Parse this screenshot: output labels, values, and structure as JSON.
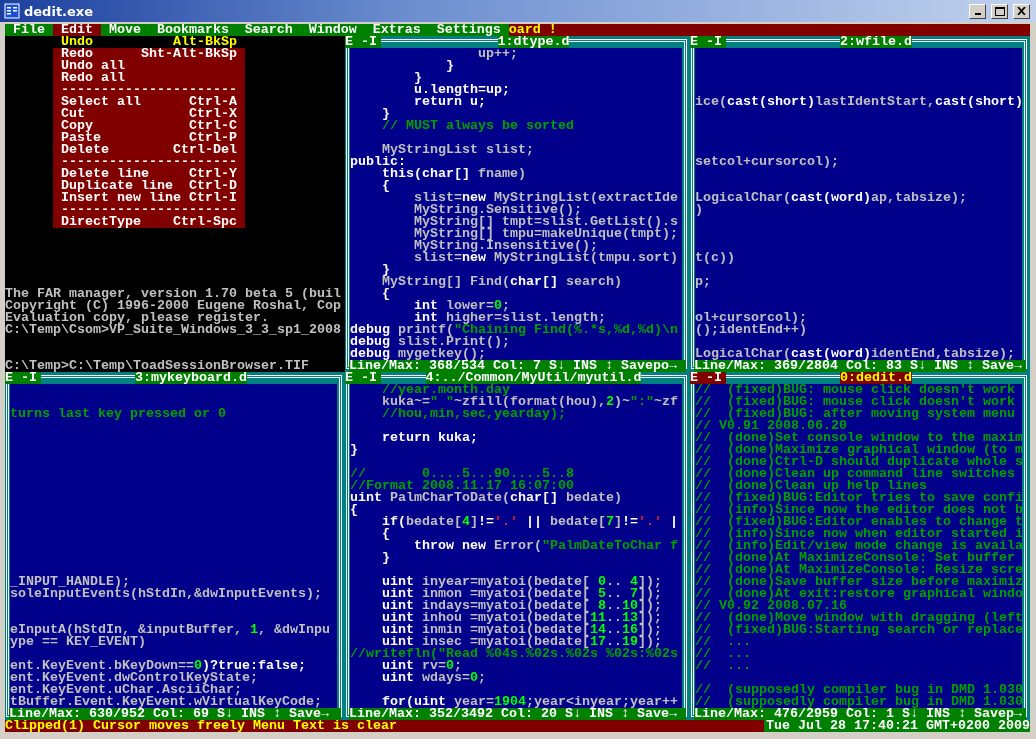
{
  "window": {
    "title": "dedit.exe"
  },
  "menu": {
    "items": [
      {
        "label": "File",
        "selected": false
      },
      {
        "label": "Edit",
        "selected": true
      },
      {
        "label": "Move",
        "selected": false
      },
      {
        "label": "Bookmarks",
        "selected": false
      },
      {
        "label": "Search",
        "selected": false
      },
      {
        "label": "Window",
        "selected": false
      },
      {
        "label": "Extras",
        "selected": false
      },
      {
        "label": "Settings",
        "selected": false
      }
    ],
    "background_text": "oard !"
  },
  "dropdown": [
    {
      "kind": "item",
      "label": "Undo",
      "shortcut": "Alt-BkSp",
      "selected": true
    },
    {
      "kind": "item",
      "label": "Redo",
      "shortcut": "Sht-Alt-BkSp",
      "selected": false
    },
    {
      "kind": "item",
      "label": "Undo all",
      "selected": false
    },
    {
      "kind": "item",
      "label": "Redo all",
      "selected": false
    },
    {
      "kind": "separator",
      "label": "----------------------",
      "selected": false
    },
    {
      "kind": "item",
      "label": "Select all",
      "shortcut": "Ctrl-A",
      "selected": false
    },
    {
      "kind": "item",
      "label": "Cut",
      "shortcut": "Ctrl-X",
      "selected": false
    },
    {
      "kind": "item",
      "label": "Copy",
      "shortcut": "Ctrl-C",
      "selected": false
    },
    {
      "kind": "item",
      "label": "Paste",
      "shortcut": "Ctrl-P",
      "selected": false
    },
    {
      "kind": "item",
      "label": "Delete",
      "shortcut": "Ctrl-Del",
      "selected": false
    },
    {
      "kind": "separator",
      "label": "----------------------",
      "selected": false
    },
    {
      "kind": "item",
      "label": "Delete line",
      "shortcut": "Ctrl-Y",
      "selected": false
    },
    {
      "kind": "item",
      "label": "Duplicate line",
      "shortcut": "Ctrl-D",
      "selected": false
    },
    {
      "kind": "item",
      "label": "Insert new line",
      "shortcut": "Ctrl-I",
      "selected": false
    },
    {
      "kind": "separator",
      "label": "----------------------",
      "selected": false
    },
    {
      "kind": "item",
      "label": "DirectType",
      "shortcut": "Ctrl-Spc",
      "selected": false
    }
  ],
  "console": {
    "lines": [
      {
        "kind": "text",
        "text": "The FAR manager, version 1.70 beta 5 (buil"
      },
      {
        "kind": "text",
        "text": "Copyright (C) 1996-2000 Eugene Roshal, Cop"
      },
      {
        "kind": "text",
        "text": "Evaluation copy, please register."
      },
      {
        "kind": "text",
        "text": "C:\\Temp\\Csom>VP_Suite_Windows_3_3_sp1_2008"
      },
      {
        "kind": "blank"
      },
      {
        "kind": "blank"
      },
      {
        "kind": "text",
        "text": "C:\\Temp>C:\\Temp\\ToadSessionBrowser.TIF"
      }
    ]
  },
  "top_panes": [
    {
      "mode": "E -I",
      "title": "1:dtype.d",
      "active": false,
      "status": "Line/Max: 368/534 Col: 7 S↓ INS ↕ Savepo→",
      "lines": [
        {
          "kind": "code",
          "segments": [
            {
              "kind": "plain",
              "text": "                up++;"
            }
          ]
        },
        {
          "kind": "code",
          "segments": [
            {
              "kind": "key",
              "text": "            }"
            }
          ]
        },
        {
          "kind": "code",
          "segments": [
            {
              "kind": "key",
              "text": "        }"
            }
          ]
        },
        {
          "kind": "code",
          "segments": [
            {
              "kind": "key",
              "text": "        u.length=up;"
            }
          ]
        },
        {
          "kind": "code",
          "segments": [
            {
              "kind": "key",
              "text": "        return u;"
            }
          ]
        },
        {
          "kind": "code",
          "segments": [
            {
              "kind": "key",
              "text": "    }"
            }
          ]
        },
        {
          "kind": "code",
          "segments": [
            {
              "kind": "comment",
              "text": "    // MUST always be sorted"
            }
          ]
        },
        {
          "kind": "blank"
        },
        {
          "kind": "code",
          "segments": [
            {
              "kind": "plain",
              "text": "    MyStringList slist;"
            }
          ]
        },
        {
          "kind": "code",
          "segments": [
            {
              "kind": "key",
              "text": "public:"
            }
          ]
        },
        {
          "kind": "code",
          "segments": [
            {
              "kind": "key",
              "text": "    this(char[]"
            },
            {
              "kind": "plain",
              "text": " fname)"
            }
          ]
        },
        {
          "kind": "code",
          "segments": [
            {
              "kind": "key",
              "text": "    {"
            }
          ]
        },
        {
          "kind": "code",
          "segments": [
            {
              "kind": "plain",
              "text": "        slist="
            },
            {
              "kind": "key",
              "text": "new"
            },
            {
              "kind": "plain",
              "text": " MyStringList(extractIde"
            }
          ]
        },
        {
          "kind": "code",
          "segments": [
            {
              "kind": "plain",
              "text": "        MyString.Sensitive();"
            }
          ]
        },
        {
          "kind": "code",
          "segments": [
            {
              "kind": "plain",
              "text": "        MyString[] tmpt=slist.GetList().s"
            }
          ]
        },
        {
          "kind": "code",
          "segments": [
            {
              "kind": "plain",
              "text": "        MyString[] tmpu=makeUnique(tmpt);"
            }
          ]
        },
        {
          "kind": "code",
          "segments": [
            {
              "kind": "plain",
              "text": "        MyString.Insensitive();"
            }
          ]
        },
        {
          "kind": "code",
          "segments": [
            {
              "kind": "plain",
              "text": "        slist="
            },
            {
              "kind": "key",
              "text": "new"
            },
            {
              "kind": "plain",
              "text": " MyStringList(tmpu.sort)"
            }
          ]
        },
        {
          "kind": "code",
          "segments": [
            {
              "kind": "key",
              "text": "    }"
            }
          ]
        },
        {
          "kind": "code",
          "segments": [
            {
              "kind": "plain",
              "text": "    MyString[] Find("
            },
            {
              "kind": "key",
              "text": "char[]"
            },
            {
              "kind": "plain",
              "text": " search)"
            }
          ]
        },
        {
          "kind": "code",
          "segments": [
            {
              "kind": "key",
              "text": "    {"
            }
          ]
        },
        {
          "kind": "code",
          "segments": [
            {
              "kind": "key",
              "text": "        int"
            },
            {
              "kind": "plain",
              "text": " lower="
            },
            {
              "kind": "number",
              "text": "0"
            },
            {
              "kind": "plain",
              "text": ";"
            }
          ]
        },
        {
          "kind": "code",
          "segments": [
            {
              "kind": "key",
              "text": "        int"
            },
            {
              "kind": "plain",
              "text": " higher=slist.length;"
            }
          ]
        },
        {
          "kind": "code",
          "segments": [
            {
              "kind": "key",
              "text": "debug"
            },
            {
              "kind": "plain",
              "text": " printf("
            },
            {
              "kind": "comment",
              "text": "\"Chaining Find(%.*s,%d,%d)\\n"
            }
          ]
        },
        {
          "kind": "code",
          "segments": [
            {
              "kind": "key",
              "text": "debug"
            },
            {
              "kind": "plain",
              "text": " slist.Print();"
            }
          ]
        },
        {
          "kind": "code",
          "segments": [
            {
              "kind": "key",
              "text": "debug"
            },
            {
              "kind": "plain",
              "text": " mygetkey();"
            }
          ]
        }
      ]
    },
    {
      "mode": "E -I",
      "title": "2:wfile.d",
      "active": false,
      "status": "Line/Max: 369/2804 Col: 83 S↓ INS ↕ Save→",
      "lines": [
        {
          "kind": "blank"
        },
        {
          "kind": "blank"
        },
        {
          "kind": "blank"
        },
        {
          "kind": "blank"
        },
        {
          "kind": "code",
          "segments": [
            {
              "kind": "plain",
              "text": "ice("
            },
            {
              "kind": "key",
              "text": "cast(short)"
            },
            {
              "kind": "plain",
              "text": "lastIdentStart,"
            },
            {
              "kind": "key",
              "text": "cast(short)"
            }
          ]
        },
        {
          "kind": "blank"
        },
        {
          "kind": "blank"
        },
        {
          "kind": "blank"
        },
        {
          "kind": "blank"
        },
        {
          "kind": "code",
          "segments": [
            {
              "kind": "plain",
              "text": "setcol+cursorcol);"
            }
          ]
        },
        {
          "kind": "blank"
        },
        {
          "kind": "blank"
        },
        {
          "kind": "code",
          "segments": [
            {
              "kind": "plain",
              "text": "LogicalChar("
            },
            {
              "kind": "key",
              "text": "cast(word)"
            },
            {
              "kind": "plain",
              "text": "ap,tabsize);"
            }
          ]
        },
        {
          "kind": "code",
          "segments": [
            {
              "kind": "plain",
              "text": ")"
            }
          ]
        },
        {
          "kind": "blank"
        },
        {
          "kind": "blank"
        },
        {
          "kind": "blank"
        },
        {
          "kind": "code",
          "segments": [
            {
              "kind": "plain",
              "text": "t(c))"
            }
          ]
        },
        {
          "kind": "blank"
        },
        {
          "kind": "code",
          "segments": [
            {
              "kind": "plain",
              "text": "p;"
            }
          ]
        },
        {
          "kind": "blank"
        },
        {
          "kind": "blank"
        },
        {
          "kind": "code",
          "segments": [
            {
              "kind": "plain",
              "text": "ol+cursorcol);"
            }
          ]
        },
        {
          "kind": "code",
          "segments": [
            {
              "kind": "plain",
              "text": "();identEnd++)"
            }
          ]
        },
        {
          "kind": "blank"
        },
        {
          "kind": "code",
          "segments": [
            {
              "kind": "plain",
              "text": "LogicalChar("
            },
            {
              "kind": "key",
              "text": "cast(word)"
            },
            {
              "kind": "plain",
              "text": "identEnd,tabsize);"
            }
          ]
        }
      ]
    }
  ],
  "bottom_panes": [
    {
      "mode": "E -I",
      "title": "3:mykeyboard.d",
      "active": false,
      "status": "Line/Max: 630/952 Col: 69 S↓ INS ↕ Save→",
      "lines": [
        {
          "kind": "blank"
        },
        {
          "kind": "blank"
        },
        {
          "kind": "code",
          "segments": [
            {
              "kind": "comment",
              "text": "turns last key pressed or 0"
            }
          ]
        },
        {
          "kind": "blank"
        },
        {
          "kind": "blank"
        },
        {
          "kind": "blank"
        },
        {
          "kind": "blank"
        },
        {
          "kind": "blank"
        },
        {
          "kind": "blank"
        },
        {
          "kind": "blank"
        },
        {
          "kind": "blank"
        },
        {
          "kind": "blank"
        },
        {
          "kind": "blank"
        },
        {
          "kind": "blank"
        },
        {
          "kind": "blank"
        },
        {
          "kind": "blank"
        },
        {
          "kind": "code",
          "segments": [
            {
              "kind": "plain",
              "text": "_INPUT_HANDLE);"
            }
          ]
        },
        {
          "kind": "code",
          "segments": [
            {
              "kind": "plain",
              "text": "soleInputEvents(hStdIn,&dwInputEvents);"
            }
          ]
        },
        {
          "kind": "blank"
        },
        {
          "kind": "blank"
        },
        {
          "kind": "code",
          "segments": [
            {
              "kind": "plain",
              "text": "eInputA(hStdIn, &inputBuffer, "
            },
            {
              "kind": "number",
              "text": "1"
            },
            {
              "kind": "plain",
              "text": ", &dwInpu"
            }
          ]
        },
        {
          "kind": "code",
          "segments": [
            {
              "kind": "plain",
              "text": "ype == KEY_EVENT)"
            }
          ]
        },
        {
          "kind": "blank"
        },
        {
          "kind": "code",
          "segments": [
            {
              "kind": "plain",
              "text": "ent.KeyEvent.bKeyDown=="
            },
            {
              "kind": "number",
              "text": "0"
            },
            {
              "kind": "key",
              "text": ")?true:false;"
            }
          ]
        },
        {
          "kind": "code",
          "segments": [
            {
              "kind": "plain",
              "text": "ent.KeyEvent.dwControlKeyState;"
            }
          ]
        },
        {
          "kind": "code",
          "segments": [
            {
              "kind": "plain",
              "text": "ent.KeyEvent.uChar.AsciiChar;"
            }
          ]
        },
        {
          "kind": "code",
          "segments": [
            {
              "kind": "plain",
              "text": "tBuffer.Event.KeyEvent.wVirtualKeyCode;"
            }
          ]
        }
      ]
    },
    {
      "mode": "E -I",
      "title": "4:../Common/MyUtil/myutil.d",
      "active": false,
      "status": "Line/Max: 352/3492 Col: 20 S↓ INS ↕ Save→",
      "lines": [
        {
          "kind": "code",
          "segments": [
            {
              "kind": "comment",
              "text": "    //year.month.day"
            }
          ]
        },
        {
          "kind": "code",
          "segments": [
            {
              "kind": "plain",
              "text": "    kuka~="
            },
            {
              "kind": "comment",
              "text": "\" \""
            },
            {
              "kind": "plain",
              "text": "~zfill(format(hou),"
            },
            {
              "kind": "number",
              "text": "2"
            },
            {
              "kind": "plain",
              "text": ")~"
            },
            {
              "kind": "comment",
              "text": "\":\""
            },
            {
              "kind": "plain",
              "text": "~zf"
            }
          ]
        },
        {
          "kind": "code",
          "segments": [
            {
              "kind": "comment",
              "text": "    //hou,min,sec,yearday);"
            }
          ]
        },
        {
          "kind": "blank"
        },
        {
          "kind": "code",
          "segments": [
            {
              "kind": "key",
              "text": "    return kuka;"
            }
          ]
        },
        {
          "kind": "code",
          "segments": [
            {
              "kind": "key",
              "text": "}"
            }
          ]
        },
        {
          "kind": "blank"
        },
        {
          "kind": "code",
          "segments": [
            {
              "kind": "comment",
              "text": "//       0....5...90....5..8"
            }
          ]
        },
        {
          "kind": "code",
          "segments": [
            {
              "kind": "comment",
              "text": "//Format 2008.11.17 16:07:00"
            }
          ]
        },
        {
          "kind": "code",
          "segments": [
            {
              "kind": "key",
              "text": "uint"
            },
            {
              "kind": "plain",
              "text": " PalmCharToDate("
            },
            {
              "kind": "key",
              "text": "char[]"
            },
            {
              "kind": "plain",
              "text": " bedate)"
            }
          ]
        },
        {
          "kind": "code",
          "segments": [
            {
              "kind": "key",
              "text": "{"
            }
          ]
        },
        {
          "kind": "code",
          "segments": [
            {
              "kind": "key",
              "text": "    if("
            },
            {
              "kind": "plain",
              "text": "bedate["
            },
            {
              "kind": "number",
              "text": "4"
            },
            {
              "kind": "plain",
              "text": "]"
            },
            {
              "kind": "key",
              "text": "!="
            },
            {
              "kind": "red",
              "text": "'.'"
            },
            {
              "kind": "key",
              "text": " || "
            },
            {
              "kind": "plain",
              "text": "bedate["
            },
            {
              "kind": "number",
              "text": "7"
            },
            {
              "kind": "plain",
              "text": "]"
            },
            {
              "kind": "key",
              "text": "!="
            },
            {
              "kind": "red",
              "text": "'.'"
            },
            {
              "kind": "key",
              "text": " |"
            }
          ]
        },
        {
          "kind": "code",
          "segments": [
            {
              "kind": "key",
              "text": "    {"
            }
          ]
        },
        {
          "kind": "code",
          "segments": [
            {
              "kind": "key",
              "text": "        throw new"
            },
            {
              "kind": "plain",
              "text": " Error("
            },
            {
              "kind": "comment",
              "text": "\"PalmDateToChar f"
            }
          ]
        },
        {
          "kind": "code",
          "segments": [
            {
              "kind": "key",
              "text": "    }"
            }
          ]
        },
        {
          "kind": "blank"
        },
        {
          "kind": "code",
          "segments": [
            {
              "kind": "key",
              "text": "    uint"
            },
            {
              "kind": "plain",
              "text": " inyear=myatoi(bedate[ "
            },
            {
              "kind": "number",
              "text": "0"
            },
            {
              "kind": "plain",
              "text": ".. "
            },
            {
              "kind": "number",
              "text": "4"
            },
            {
              "kind": "plain",
              "text": "]);"
            }
          ]
        },
        {
          "kind": "code",
          "segments": [
            {
              "kind": "key",
              "text": "    uint"
            },
            {
              "kind": "plain",
              "text": " inmon =myatoi(bedate[ "
            },
            {
              "kind": "number",
              "text": "5"
            },
            {
              "kind": "plain",
              "text": ".. "
            },
            {
              "kind": "number",
              "text": "7"
            },
            {
              "kind": "plain",
              "text": "]);"
            }
          ]
        },
        {
          "kind": "code",
          "segments": [
            {
              "kind": "key",
              "text": "    uint"
            },
            {
              "kind": "plain",
              "text": " indays=myatoi(bedate[ "
            },
            {
              "kind": "number",
              "text": "8"
            },
            {
              "kind": "plain",
              "text": ".."
            },
            {
              "kind": "number",
              "text": "10"
            },
            {
              "kind": "plain",
              "text": "]);"
            }
          ]
        },
        {
          "kind": "code",
          "segments": [
            {
              "kind": "key",
              "text": "    uint"
            },
            {
              "kind": "plain",
              "text": " inhou =myatoi(bedate["
            },
            {
              "kind": "number",
              "text": "11"
            },
            {
              "kind": "plain",
              "text": ".."
            },
            {
              "kind": "number",
              "text": "13"
            },
            {
              "kind": "plain",
              "text": "]);"
            }
          ]
        },
        {
          "kind": "code",
          "segments": [
            {
              "kind": "key",
              "text": "    uint"
            },
            {
              "kind": "plain",
              "text": " inmin =myatoi(bedate["
            },
            {
              "kind": "number",
              "text": "14"
            },
            {
              "kind": "plain",
              "text": ".."
            },
            {
              "kind": "number",
              "text": "16"
            },
            {
              "kind": "plain",
              "text": "]);"
            }
          ]
        },
        {
          "kind": "code",
          "segments": [
            {
              "kind": "key",
              "text": "    uint"
            },
            {
              "kind": "plain",
              "text": " insec =myatoi(bedate["
            },
            {
              "kind": "number",
              "text": "17"
            },
            {
              "kind": "plain",
              "text": ".."
            },
            {
              "kind": "number",
              "text": "19"
            },
            {
              "kind": "plain",
              "text": "]);"
            }
          ]
        },
        {
          "kind": "code",
          "segments": [
            {
              "kind": "comment",
              "text": "//writefln(\"Read %04s.%02s.%02s %02s:%02s"
            }
          ]
        },
        {
          "kind": "code",
          "segments": [
            {
              "kind": "key",
              "text": "    uint"
            },
            {
              "kind": "plain",
              "text": " rv="
            },
            {
              "kind": "number",
              "text": "0"
            },
            {
              "kind": "plain",
              "text": ";"
            }
          ]
        },
        {
          "kind": "code",
          "segments": [
            {
              "kind": "key",
              "text": "    uint"
            },
            {
              "kind": "plain",
              "text": " wdays="
            },
            {
              "kind": "number",
              "text": "0"
            },
            {
              "kind": "plain",
              "text": ";"
            }
          ]
        },
        {
          "kind": "blank"
        },
        {
          "kind": "code",
          "segments": [
            {
              "kind": "key",
              "text": "    for(uint"
            },
            {
              "kind": "plain",
              "text": " year="
            },
            {
              "kind": "number",
              "text": "1904"
            },
            {
              "kind": "plain",
              "text": ";year<inyear;year++"
            }
          ]
        }
      ]
    },
    {
      "mode": "E -I",
      "title": "0:dedit.d",
      "active": true,
      "status": "Line/Max: 476/2959 Col: 1 S↓ INS ↕ Savep→",
      "lines": [
        {
          "kind": "code",
          "segments": [
            {
              "kind": "comment",
              "text": "//  (fixed)BUG: mouse click doesn't work"
            }
          ]
        },
        {
          "kind": "code",
          "segments": [
            {
              "kind": "comment",
              "text": "//  (fixed)BUG: mouse click doesn't work"
            }
          ]
        },
        {
          "kind": "code",
          "segments": [
            {
              "kind": "comment",
              "text": "//  (fixed)BUG: after moving system menu"
            }
          ]
        },
        {
          "kind": "code",
          "segments": [
            {
              "kind": "comment",
              "text": "// V0.91 2008.06.20"
            }
          ]
        },
        {
          "kind": "code",
          "segments": [
            {
              "kind": "comment",
              "text": "//  (done)Set console window to the maxim"
            }
          ]
        },
        {
          "kind": "code",
          "segments": [
            {
              "kind": "comment",
              "text": "//  (done)Maximize graphical window (to m"
            }
          ]
        },
        {
          "kind": "code",
          "segments": [
            {
              "kind": "comment",
              "text": "//  (done)Ctrl-D should duplicate whole s"
            }
          ]
        },
        {
          "kind": "code",
          "segments": [
            {
              "kind": "comment",
              "text": "//  (done)Clean up command line switches"
            }
          ]
        },
        {
          "kind": "code",
          "segments": [
            {
              "kind": "comment",
              "text": "//  (done)Clean up help lines"
            }
          ]
        },
        {
          "kind": "code",
          "segments": [
            {
              "kind": "comment",
              "text": "//  (fixed)BUG:Editor tries to save confi"
            }
          ]
        },
        {
          "kind": "code",
          "segments": [
            {
              "kind": "comment",
              "text": "//  (info)Since now the editor does not b"
            }
          ]
        },
        {
          "kind": "code",
          "segments": [
            {
              "kind": "comment",
              "text": "//  (fixed)BUG:Editor enables to change t"
            }
          ]
        },
        {
          "kind": "code",
          "segments": [
            {
              "kind": "comment",
              "text": "//  (info)Since now when editor started i"
            }
          ]
        },
        {
          "kind": "code",
          "segments": [
            {
              "kind": "comment",
              "text": "//  (info)Edit/view mode change is availa"
            }
          ]
        },
        {
          "kind": "code",
          "segments": [
            {
              "kind": "comment",
              "text": "//  (done)At MaximizeConsole: Set buffer"
            }
          ]
        },
        {
          "kind": "code",
          "segments": [
            {
              "kind": "comment",
              "text": "//  (done)At MaximizeConsole: Resize scre"
            }
          ]
        },
        {
          "kind": "code",
          "segments": [
            {
              "kind": "comment",
              "text": "//  (done)Save buffer size before maximiz"
            }
          ]
        },
        {
          "kind": "code",
          "segments": [
            {
              "kind": "comment",
              "text": "//  (done)At exit:restore graphical windo"
            }
          ]
        },
        {
          "kind": "code",
          "segments": [
            {
              "kind": "comment",
              "text": "// V0.92 2008.07.16"
            }
          ]
        },
        {
          "kind": "code",
          "segments": [
            {
              "kind": "comment",
              "text": "//  (done)Move window with dragging (left"
            }
          ]
        },
        {
          "kind": "code",
          "segments": [
            {
              "kind": "comment",
              "text": "//  (fixed)BUG:Starting search or replace"
            }
          ]
        },
        {
          "kind": "code",
          "segments": [
            {
              "kind": "comment",
              "text": "//  ..."
            }
          ]
        },
        {
          "kind": "code",
          "segments": [
            {
              "kind": "comment",
              "text": "//  ..."
            }
          ]
        },
        {
          "kind": "code",
          "segments": [
            {
              "kind": "comment",
              "text": "//  ..."
            }
          ]
        },
        {
          "kind": "blank"
        },
        {
          "kind": "code",
          "segments": [
            {
              "kind": "comment",
              "text": "//  (supposedly compiler bug in DMD 1.030"
            }
          ]
        },
        {
          "kind": "code",
          "segments": [
            {
              "kind": "comment",
              "text": "//  (supposedly compiler bug in DMD 1.030"
            }
          ]
        }
      ]
    }
  ],
  "status_bar": {
    "message": "Clipped(1) Cursor moves freely Menu Text is clear",
    "clock": "Tue Jul 28 17:40:21 GMT+0200 2009"
  }
}
